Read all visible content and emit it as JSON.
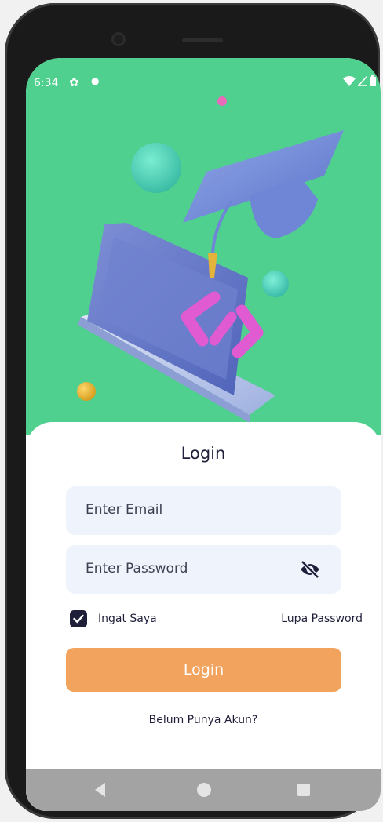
{
  "status_bar": {
    "time": "6:34",
    "left_icons": [
      "gear-icon",
      "dot-icon"
    ],
    "right_icons": [
      "wifi-icon",
      "signal-icon",
      "battery-icon"
    ]
  },
  "hero": {
    "background": "#4fd08f",
    "illustration": "graduation-laptop-illustration"
  },
  "login": {
    "title": "Login",
    "email_placeholder": "Enter Email",
    "password_placeholder": "Enter Password",
    "password_toggle_icon": "eye-off-icon",
    "remember_label": "Ingat Saya",
    "remember_checked": true,
    "forgot_label": "Lupa Password",
    "submit_label": "Login",
    "register_label": "Belum Punya Akun?"
  },
  "colors": {
    "accent": "#f2a35e",
    "field_bg": "#eef3fc",
    "text_dark": "#1f1f3a",
    "hero_green": "#4fd08f"
  },
  "nav_bar": {
    "icons": [
      "back-icon",
      "home-icon",
      "recents-icon"
    ]
  }
}
